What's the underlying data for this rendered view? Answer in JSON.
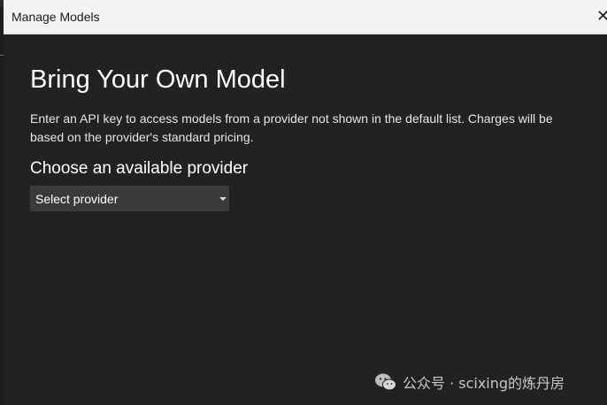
{
  "dialog": {
    "title": "Manage Models",
    "close_glyph": "✕",
    "heading": "Bring Your Own Model",
    "description": "Enter an API key to access models from a provider not shown in the default list. Charges will be based on the provider's standard pricing.",
    "provider_section_label": "Choose an available provider",
    "provider_select": {
      "value": "Select provider"
    }
  },
  "watermark": {
    "text": "公众号 · scixing的炼丹房",
    "icon": "wechat-icon"
  },
  "colors": {
    "dialog_bg": "#222222",
    "titlebar_bg": "#f3f3f3",
    "select_bg": "#3a3a3a",
    "text_primary": "#ffffff"
  }
}
